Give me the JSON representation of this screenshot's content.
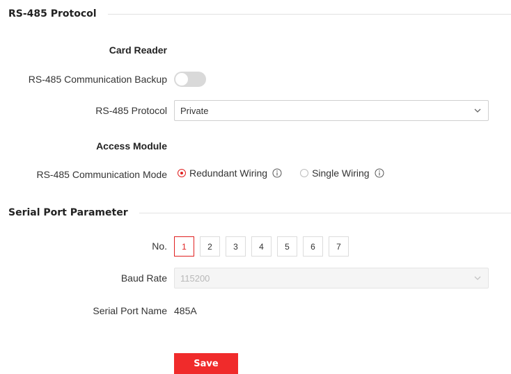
{
  "rs485_section": {
    "title": "RS-485 Protocol",
    "card_reader": {
      "heading": "Card Reader",
      "backup_label": "RS-485 Communication Backup",
      "backup_enabled": false,
      "protocol_label": "RS-485 Protocol",
      "protocol_value": "Private"
    },
    "access_module": {
      "heading": "Access Module",
      "mode_label": "RS-485 Communication Mode",
      "options": [
        {
          "label": "Redundant Wiring",
          "selected": true
        },
        {
          "label": "Single Wiring",
          "selected": false
        }
      ]
    }
  },
  "serial_section": {
    "title": "Serial Port Parameter",
    "no_label": "No.",
    "ports": [
      "1",
      "2",
      "3",
      "4",
      "5",
      "6",
      "7"
    ],
    "active_port": "1",
    "baud_label": "Baud Rate",
    "baud_value": "115200",
    "port_name_label": "Serial Port Name",
    "port_name_value": "485A"
  },
  "actions": {
    "save_label": "Save"
  },
  "colors": {
    "accent": "#f02b2b",
    "toggle_off": "#d9d9d9",
    "divider": "#e2e2e2"
  },
  "icons": {
    "info": "info-circle-icon",
    "dropdown": "chevron-down-icon"
  }
}
